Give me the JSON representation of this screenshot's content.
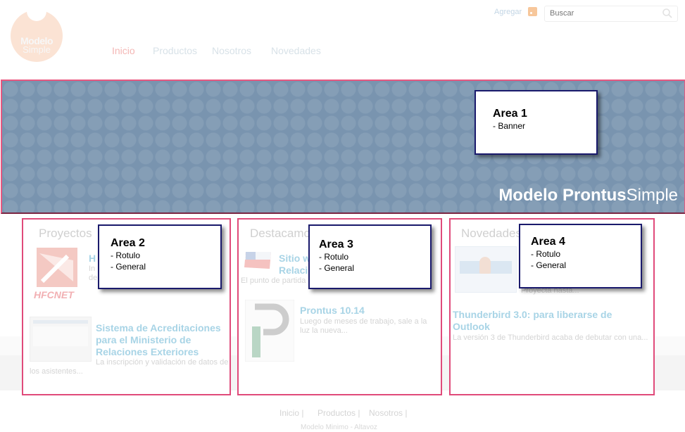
{
  "header": {
    "logo_line1": "Modelo",
    "logo_line2": "Simple",
    "nav": [
      "Inicio",
      "Productos",
      "Nosotros",
      "Novedades"
    ],
    "agregar": "Agregar",
    "search_placeholder": "Buscar"
  },
  "banner": {
    "brand_bold": "Modelo Prontus",
    "brand_light": "Simple",
    "color": "#7994af"
  },
  "areas": [
    {
      "title": "Area 1",
      "lines": [
        "- Banner"
      ]
    },
    {
      "title": "Area 2",
      "lines": [
        "- Rotulo",
        "- General"
      ]
    },
    {
      "title": "Area 3",
      "lines": [
        "- Rotulo",
        "- General"
      ]
    },
    {
      "title": "Area 4",
      "lines": [
        "- Rotulo",
        "- General"
      ]
    }
  ],
  "columns": {
    "proyectos": {
      "head": "Proyectos",
      "item1_title": "H",
      "item1_desc": "In",
      "item1_desc2": "de",
      "logo_text": "HFCNET",
      "item2_title": "Sistema de Acreditaciones para el Ministerio de Relaciones Exteriores",
      "item2_desc": "La inscripción y validación de datos de los asistentes..."
    },
    "destacamos": {
      "head": "Destacamo",
      "item1_title": "Sitio w",
      "item1_title2": "Relaci",
      "item1_desc": "El punto de partida",
      "item2_title": "Prontus 10.14",
      "item2_desc": "Luego de meses de trabajo, sale a la luz la nueva..."
    },
    "novedades": {
      "head": "Novedades",
      "item1_desc": "Proyecta hasta...",
      "item2_title": "Thunderbird 3.0: para liberarse de Outlook",
      "item2_desc": "La versión 3 de Thunderbird acaba de debutar con una..."
    }
  },
  "footer": {
    "nav": [
      "Inicio |",
      "Productos |",
      "Nosotros |"
    ],
    "note": "Modelo Minimo - Altavoz"
  },
  "colors": {
    "area_border": "#e04a7a",
    "box_border": "#1a1a6c"
  }
}
